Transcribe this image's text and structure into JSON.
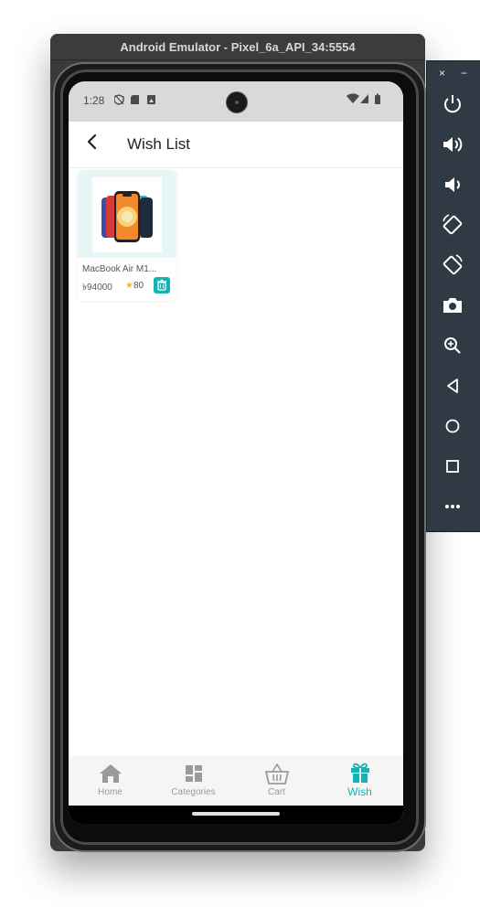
{
  "emulator": {
    "title": "Android Emulator - Pixel_6a_API_34:5554"
  },
  "status_bar": {
    "time": "1:28"
  },
  "app_bar": {
    "title": "Wish List"
  },
  "wishlist": {
    "items": [
      {
        "title": "MacBook Air M1...",
        "price": "৳94000",
        "rating_star": "★",
        "rating": "80"
      }
    ]
  },
  "bottom_nav": {
    "items": [
      {
        "label": "Home",
        "icon": "home-icon"
      },
      {
        "label": "Categories",
        "icon": "categories-icon"
      },
      {
        "label": "Cart",
        "icon": "cart-icon"
      },
      {
        "label": "Wish",
        "icon": "gift-icon",
        "active": true
      }
    ]
  },
  "side_toolbar": {
    "close": "×",
    "minimize": "−",
    "buttons": [
      "power-icon",
      "volume-up-icon",
      "volume-down-icon",
      "rotate-left-icon",
      "rotate-right-icon",
      "camera-icon",
      "zoom-icon",
      "back-icon",
      "home-icon",
      "overview-icon",
      "more-icon"
    ]
  },
  "colors": {
    "accent": "#15b3b3",
    "card_bg": "#e6f6f7",
    "star": "#f2b824",
    "nav_inactive": "#9a9a9a"
  }
}
